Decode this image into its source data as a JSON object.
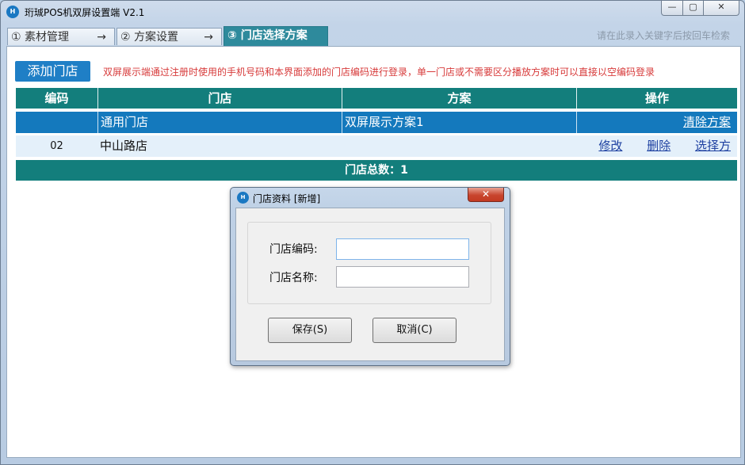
{
  "window": {
    "title": "珩珹POS机双屏设置端 V2.1",
    "icon_letter": "H",
    "min_glyph": "—",
    "max_glyph": "▢",
    "close_glyph": "✕"
  },
  "tabs": [
    {
      "label": "① 素材管理",
      "arrow": "→"
    },
    {
      "label": "② 方案设置",
      "arrow": "→"
    },
    {
      "label": "③ 门店选择方案"
    }
  ],
  "search_hint": "请在此录入关键字后按回车检索",
  "toolbar": {
    "add_label": "添加门店",
    "notice": "双屏展示端通过注册时使用的手机号码和本界面添加的门店编码进行登录，单一门店或不需要区分播放方案时可以直接以空编码登录"
  },
  "table": {
    "headers": [
      "编码",
      "门店",
      "方案",
      "操作"
    ],
    "rows": [
      {
        "code": "",
        "store": "通用门店",
        "scheme": "双屏展示方案1",
        "actions": [
          "清除方案"
        ]
      },
      {
        "code": "02",
        "store": "中山路店",
        "scheme": "",
        "actions": [
          "修改",
          "删除",
          "选择方案"
        ]
      }
    ],
    "total_label": "门店总数：1"
  },
  "dialog": {
    "title": "门店资料 [新增]",
    "close_glyph": "✕",
    "code_label": "门店编码:",
    "name_label": "门店名称:",
    "code_value": "",
    "name_value": "",
    "save_label": "保存(S)",
    "cancel_label": "取消(C)"
  },
  "colors": {
    "teal": "#137e7c",
    "blue": "#1479bd",
    "notice_red": "#d73a3a",
    "link": "#1c3fa0"
  }
}
